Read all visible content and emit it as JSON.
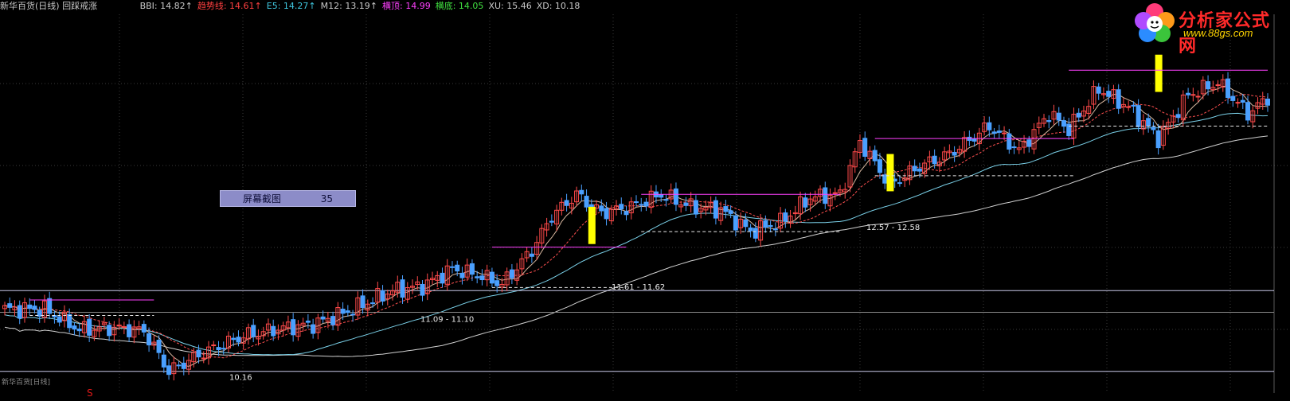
{
  "header": {
    "title": "新华百货(日线) 回踩戒涨",
    "title_color": "#c8c8c8",
    "indicators": [
      {
        "label": "BBI:",
        "value": "14.82",
        "arrow": "↑",
        "color": "#c8c8c8"
      },
      {
        "label": "趋势线:",
        "value": "14.61",
        "arrow": "↑",
        "color": "#ff4040"
      },
      {
        "label": "E5:",
        "value": "14.27",
        "arrow": "↑",
        "color": "#40c8e0"
      },
      {
        "label": "M12:",
        "value": "13.19",
        "arrow": "↑",
        "color": "#c8c8c8"
      },
      {
        "label": "横顶:",
        "value": "14.99",
        "arrow": "",
        "color": "#ff40ff"
      },
      {
        "label": "横底:",
        "value": "14.05",
        "arrow": "",
        "color": "#40e040"
      },
      {
        "label": "XU:",
        "value": "15.46",
        "arrow": "",
        "color": "#c8c8c8"
      },
      {
        "label": "XD:",
        "value": "10.18",
        "arrow": "",
        "color": "#c8c8c8"
      }
    ]
  },
  "screenshot_box": {
    "label": "屏幕截图",
    "count": "35"
  },
  "logo": {
    "brand": "分析家公式网",
    "url": "www.88gs.com"
  },
  "left_label": "新华百货[日线]",
  "s_mark": "S",
  "colors": {
    "up": "#ff4a4a",
    "down": "#4aa0ff",
    "signal": "#ffff00",
    "box_top": "#ff40ff",
    "box_bottom": "#e8e8e8"
  },
  "chart_data": {
    "type": "candlestick",
    "title": "新华百货(日线)",
    "xlabel": "",
    "ylabel": "",
    "ylim": [
      9.9,
      16.0
    ],
    "grid": true,
    "annotations": [
      {
        "text": "10.16",
        "x": 0.18,
        "price": 10.16
      },
      {
        "text": "11.09 - 11.10",
        "x": 0.33,
        "price": 11.1
      },
      {
        "text": "11.61 - 11.62",
        "x": 0.48,
        "price": 11.62
      },
      {
        "text": "12.57 - 12.58",
        "x": 0.68,
        "price": 12.58
      }
    ],
    "series": [
      {
        "name": "BBI",
        "color": "#c8c8c8"
      },
      {
        "name": "趋势线",
        "color": "#ff4040"
      },
      {
        "name": "E5",
        "color": "#40c8e0"
      },
      {
        "name": "M12",
        "color": "#c8c8c8"
      },
      {
        "name": "XU",
        "color": "#c8c8c8"
      },
      {
        "name": "XD",
        "color": "#c8c8c8"
      }
    ],
    "last_values": {
      "BBI": 14.82,
      "趋势线": 14.61,
      "E5": 14.27,
      "M12": 13.19,
      "横顶": 14.99,
      "横底": 14.05,
      "XU": 15.46,
      "XD": 10.18
    },
    "anchors": [
      [
        0,
        11.25
      ],
      [
        8,
        11.25
      ],
      [
        15,
        10.92
      ],
      [
        22,
        10.95
      ],
      [
        28,
        10.9
      ],
      [
        33,
        10.25
      ],
      [
        40,
        10.55
      ],
      [
        48,
        10.82
      ],
      [
        56,
        10.95
      ],
      [
        62,
        11.0
      ],
      [
        70,
        11.25
      ],
      [
        78,
        11.55
      ],
      [
        84,
        11.62
      ],
      [
        90,
        11.9
      ],
      [
        96,
        11.78
      ],
      [
        100,
        11.65
      ],
      [
        106,
        12.2
      ],
      [
        110,
        12.75
      ],
      [
        115,
        13.1
      ],
      [
        120,
        12.8
      ],
      [
        126,
        12.9
      ],
      [
        132,
        13.1
      ],
      [
        138,
        12.9
      ],
      [
        144,
        12.85
      ],
      [
        150,
        12.5
      ],
      [
        156,
        12.65
      ],
      [
        162,
        13.05
      ],
      [
        168,
        13.1
      ],
      [
        172,
        13.95
      ],
      [
        178,
        13.25
      ],
      [
        184,
        13.55
      ],
      [
        190,
        13.75
      ],
      [
        198,
        14.2
      ],
      [
        204,
        13.8
      ],
      [
        210,
        14.4
      ],
      [
        214,
        14.15
      ],
      [
        220,
        14.8
      ],
      [
        226,
        14.5
      ],
      [
        232,
        14.0
      ],
      [
        238,
        14.7
      ],
      [
        244,
        14.9
      ],
      [
        250,
        14.4
      ],
      [
        254,
        14.65
      ]
    ]
  }
}
